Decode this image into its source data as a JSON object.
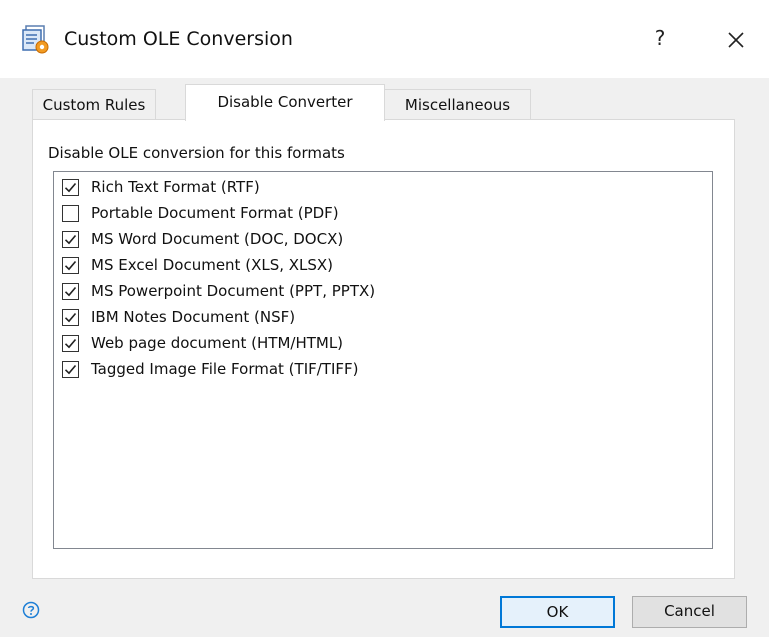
{
  "window": {
    "title": "Custom OLE Conversion",
    "help_glyph": "?",
    "icon": "app-gear-document-icon"
  },
  "tabs": [
    {
      "label": "Custom Rules",
      "active": false
    },
    {
      "label": "Disable Converter",
      "active": true
    },
    {
      "label": "Miscellaneous",
      "active": false
    }
  ],
  "panel": {
    "label": "Disable OLE conversion for this formats",
    "items": [
      {
        "label": "Rich Text Format (RTF)",
        "checked": true
      },
      {
        "label": "Portable Document Format (PDF)",
        "checked": false
      },
      {
        "label": "MS Word Document (DOC, DOCX)",
        "checked": true
      },
      {
        "label": "MS Excel Document (XLS, XLSX)",
        "checked": true
      },
      {
        "label": "MS Powerpoint Document (PPT, PPTX)",
        "checked": true
      },
      {
        "label": "IBM Notes Document (NSF)",
        "checked": true
      },
      {
        "label": "Web page document (HTM/HTML)",
        "checked": true
      },
      {
        "label": "Tagged Image File Format (TIF/TIFF)",
        "checked": true
      }
    ]
  },
  "footer": {
    "ok_label": "OK",
    "cancel_label": "Cancel",
    "help_icon": "question-circle-icon"
  },
  "colors": {
    "accent": "#0078d7",
    "help_icon": "#1e7fd6"
  }
}
